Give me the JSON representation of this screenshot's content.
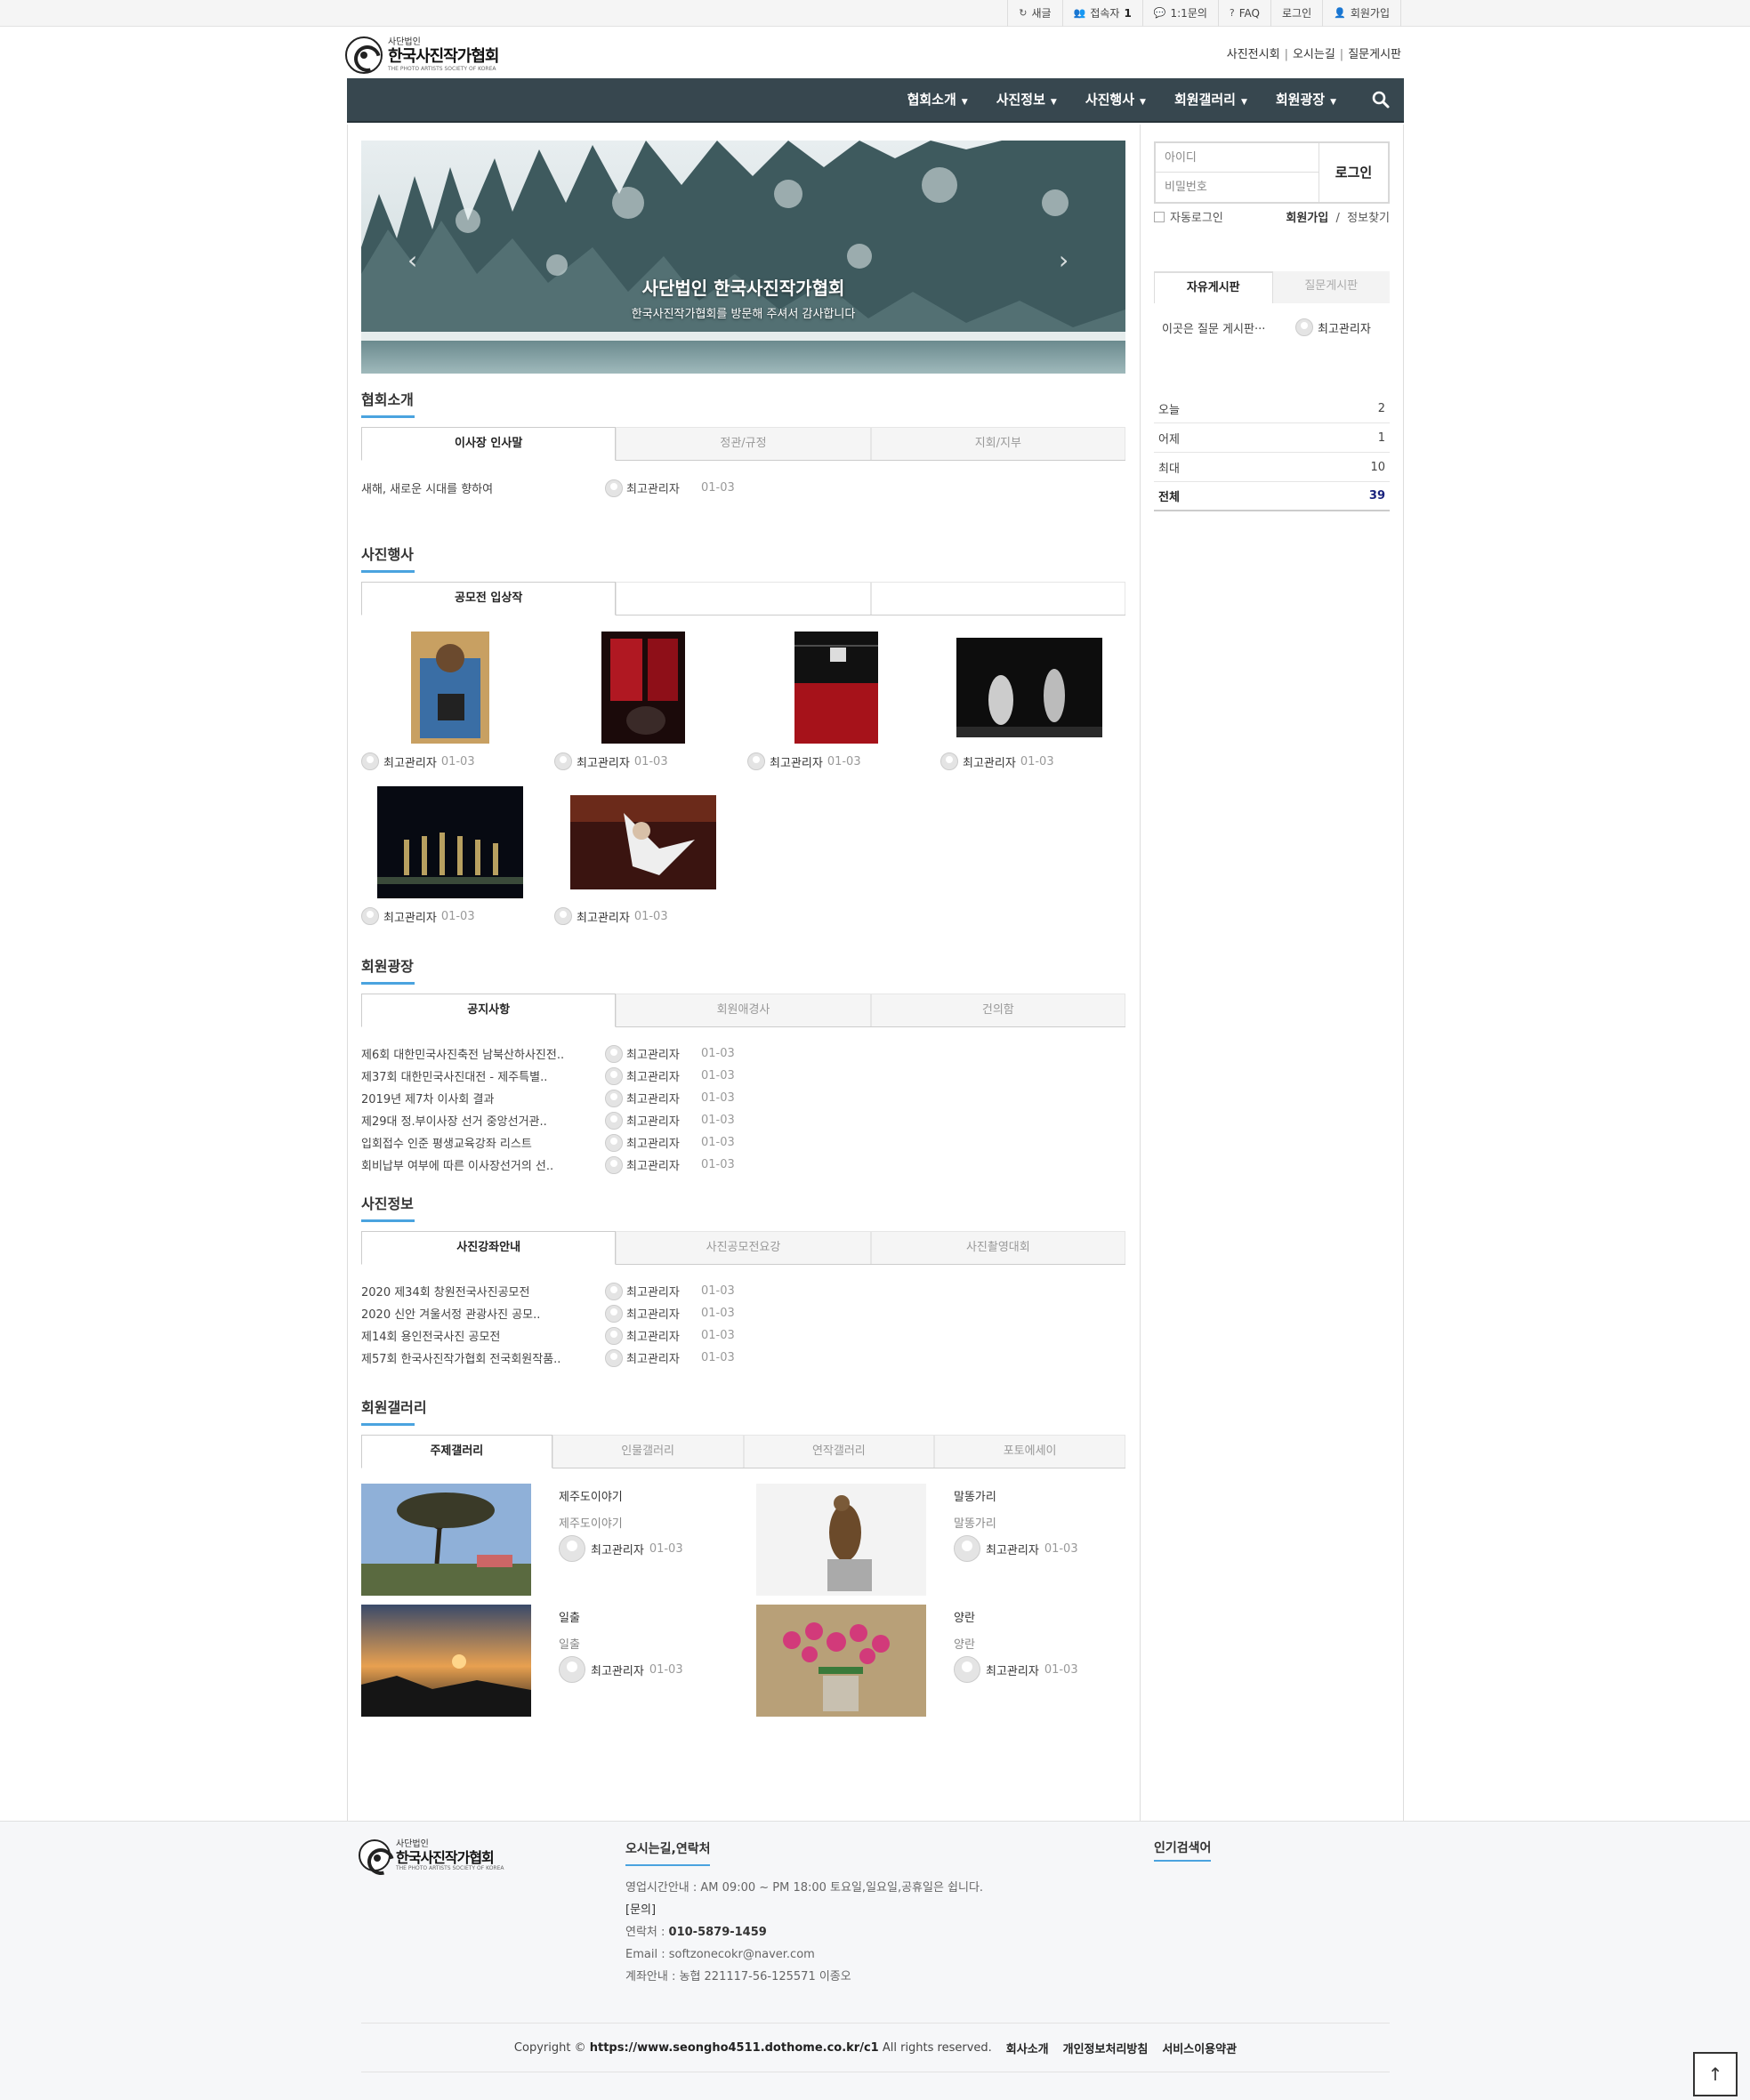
{
  "topbar": {
    "items": [
      {
        "icon": "refresh-icon",
        "label": "새글"
      },
      {
        "icon": "users-icon",
        "label": "접속자",
        "count": "1"
      },
      {
        "icon": "chat-icon",
        "label": "1:1문의"
      },
      {
        "icon": "question-icon",
        "label": "FAQ"
      },
      {
        "icon": "",
        "label": "로그인"
      },
      {
        "icon": "user-plus-icon",
        "label": "회원가입"
      }
    ]
  },
  "header": {
    "logo_small": "사단법인",
    "logo_main": "한국사진작가협회",
    "logo_en": "THE PHOTO ARTISTS SOCIETY OF KOREA",
    "links": [
      "사진전시회",
      "오시는길",
      "질문게시판"
    ]
  },
  "nav": {
    "items": [
      "협회소개",
      "사진정보",
      "사진행사",
      "회원갤러리",
      "회원광장"
    ]
  },
  "banner": {
    "title": "사단법인 한국사진작가협회",
    "subtitle": "한국사진작가협회를 방문해 주셔서 감사합니다"
  },
  "about": {
    "title": "협회소개",
    "tabs": [
      "이사장 인사말",
      "정관/규정",
      "지회/지부"
    ],
    "posts": [
      {
        "title": "새해, 새로운 시대를 향하여",
        "author": "최고관리자",
        "date": "01-03"
      }
    ]
  },
  "events": {
    "title": "사진행사",
    "tabs": [
      "공모전 입상작",
      "",
      ""
    ],
    "photos": [
      {
        "author": "최고관리자",
        "date": "01-03"
      },
      {
        "author": "최고관리자",
        "date": "01-03"
      },
      {
        "author": "최고관리자",
        "date": "01-03"
      },
      {
        "author": "최고관리자",
        "date": "01-03"
      },
      {
        "author": "최고관리자",
        "date": "01-03"
      },
      {
        "author": "최고관리자",
        "date": "01-03"
      }
    ]
  },
  "plaza": {
    "title": "회원광장",
    "tabs": [
      "공지사항",
      "회원애경사",
      "건의함"
    ],
    "posts": [
      {
        "title": "제6회 대한민국사진축전 남북산하사진전..",
        "author": "최고관리자",
        "date": "01-03"
      },
      {
        "title": "제37회 대한민국사진대전 - 제주특별..",
        "author": "최고관리자",
        "date": "01-03"
      },
      {
        "title": "2019년 제7차 이사회 결과",
        "author": "최고관리자",
        "date": "01-03"
      },
      {
        "title": "제29대 정.부이사장 선거 중앙선거관..",
        "author": "최고관리자",
        "date": "01-03"
      },
      {
        "title": "입회접수 인준 평생교육강좌 리스트",
        "author": "최고관리자",
        "date": "01-03"
      },
      {
        "title": "회비납부 여부에 따른 이사장선거의 선..",
        "author": "최고관리자",
        "date": "01-03"
      }
    ]
  },
  "photoinfo": {
    "title": "사진정보",
    "tabs": [
      "사진강좌안내",
      "사진공모전요강",
      "사진촬영대회"
    ],
    "posts": [
      {
        "title": "2020 제34회 창원전국사진공모전",
        "author": "최고관리자",
        "date": "01-03"
      },
      {
        "title": "2020 신안 겨울서정 관광사진 공모..",
        "author": "최고관리자",
        "date": "01-03"
      },
      {
        "title": "제14회 용인전국사진 공모전",
        "author": "최고관리자",
        "date": "01-03"
      },
      {
        "title": "제57회 한국사진작가협회 전국회원작품..",
        "author": "최고관리자",
        "date": "01-03"
      }
    ]
  },
  "gallery": {
    "title": "회원갤러리",
    "tabs": [
      "주제갤러리",
      "인물갤러리",
      "연작갤러리",
      "포토에세이"
    ],
    "items": [
      {
        "title": "제주도이야기",
        "desc": "제주도이야기",
        "author": "최고관리자",
        "date": "01-03"
      },
      {
        "title": "말똥가리",
        "desc": "말똥가리",
        "author": "최고관리자",
        "date": "01-03"
      },
      {
        "title": "일출",
        "desc": "일출",
        "author": "최고관리자",
        "date": "01-03"
      },
      {
        "title": "양란",
        "desc": "양란",
        "author": "최고관리자",
        "date": "01-03"
      }
    ]
  },
  "login": {
    "id_placeholder": "아이디",
    "pw_placeholder": "비밀번호",
    "button": "로그인",
    "auto_login": "자동로그인",
    "join": "회원가입",
    "find": "정보찾기"
  },
  "side_board": {
    "tabs": [
      "자유게시판",
      "질문게시판"
    ],
    "post": {
      "title": "이곳은 질문 게시판···",
      "author": "최고관리자"
    }
  },
  "visitors": {
    "rows": [
      {
        "label": "오늘",
        "value": "2"
      },
      {
        "label": "어제",
        "value": "1"
      },
      {
        "label": "최대",
        "value": "10"
      },
      {
        "label": "전체",
        "value": "39"
      }
    ]
  },
  "footer": {
    "contact_title": "오시는길,연락처",
    "hours": "영업시간안내 : AM 09:00 ~ PM 18:00 토요일,일요일,공휴일은 쉽니다.",
    "inquiry": "[문의]",
    "phone_label": "연락처 : ",
    "phone": "010-5879-1459",
    "email": "Email : softzonecokr@naver.com",
    "account": "계좌안내 : 농협 221117-56-125571 이종오",
    "popular": "인기검색어",
    "copyright_pre": "Copyright ©",
    "copyright_url": "https://www.seongho4511.dothome.co.kr/c1",
    "copyright_post": "All rights reserved.",
    "links": [
      "회사소개",
      "개인정보처리방침",
      "서비스이용약관"
    ]
  }
}
